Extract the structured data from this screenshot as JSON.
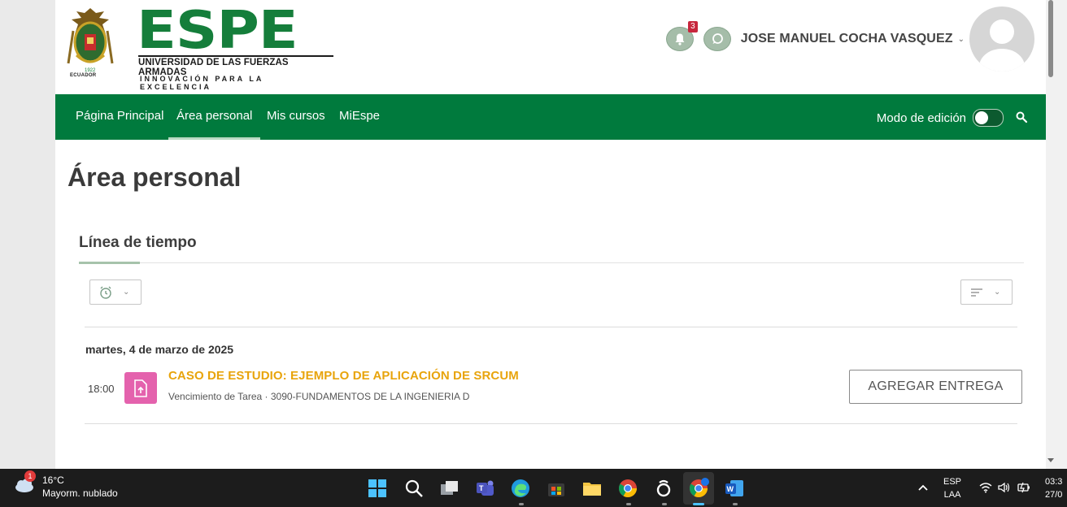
{
  "header": {
    "logo_word": "ESPE",
    "university": "UNIVERSIDAD DE LAS FUERZAS ARMADAS",
    "motto": "INNOVACIÓN PARA LA EXCELENCIA",
    "crest_country": "ECUADOR",
    "notifications_count": "3",
    "user_name": "JOSE MANUEL COCHA VASQUEZ"
  },
  "nav": {
    "items": [
      {
        "label": "Página Principal",
        "active": false
      },
      {
        "label": "Área personal",
        "active": true
      },
      {
        "label": "Mis cursos",
        "active": false
      },
      {
        "label": "MiEspe",
        "active": false
      }
    ],
    "edit_mode_label": "Modo de edición",
    "edit_mode_on": false
  },
  "main": {
    "page_title": "Área personal",
    "block_title": "Línea de tiempo",
    "timeline": {
      "date": "martes, 4 de marzo de 2025",
      "items": [
        {
          "time": "18:00",
          "title": "CASO DE ESTUDIO: EJEMPLO DE APLICACIÓN DE SRCUM",
          "subtitle": "Vencimiento de Tarea · 3090-FUNDAMENTOS DE LA INGENIERIA D",
          "action_label": "AGREGAR ENTREGA"
        }
      ]
    }
  },
  "taskbar": {
    "weather_temp": "16°C",
    "weather_desc": "Mayorm. nublado",
    "weather_badge": "1",
    "lang": "ESP",
    "layout": "LAA",
    "time": "03:3",
    "date": "27/0"
  },
  "colors": {
    "brand_green": "#007a3d",
    "accent_orange": "#e8a40c",
    "assignment_pink": "#e462ad"
  }
}
